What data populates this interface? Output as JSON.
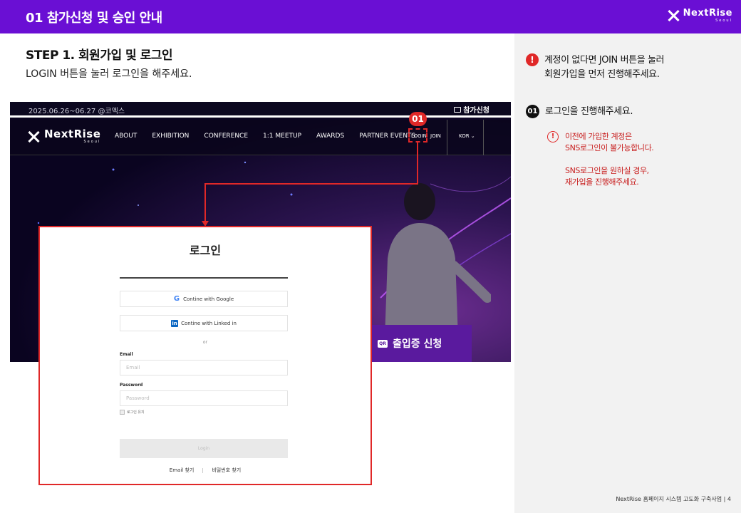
{
  "header": {
    "title": "01 참가신청 및 승인 안내",
    "brand_name": "NextRise",
    "brand_sub": "Seoul"
  },
  "step": {
    "title": "STEP 1.  회원가입 및 로그인",
    "description": "LOGIN 버튼을 눌러 로그인을 해주세요."
  },
  "site": {
    "date_info": "2025.06.26~06.27 @코엑스",
    "register_label": "참가신청",
    "logo_name": "NextRise",
    "logo_sub": "Seoul",
    "menu": [
      "ABOUT",
      "EXHIBITION",
      "CONFERENCE",
      "1:1 MEETUP",
      "AWARDS",
      "PARTNER EVENTS"
    ],
    "login": "LOGIN",
    "join": "JOIN",
    "language": "KOR ⌄",
    "qr_icon_text": "QR",
    "qr_label": "출입증 신청"
  },
  "callout": {
    "badge": "01"
  },
  "modal": {
    "title": "로그인",
    "google_icon": "G",
    "google_label": "Contine with Google",
    "linkedin_icon": "in",
    "linkedin_label": "Contine with Linked in",
    "or": "or",
    "email_label": "Email",
    "email_placeholder": "Email",
    "password_label": "Password",
    "password_placeholder": "Password",
    "remember_label": "로그인 유지",
    "login_button": "Login",
    "find_email": "Email 찾기",
    "find_password": "비밀번호 찾기"
  },
  "panel": {
    "alert_icon": "!",
    "alert_line1": "계정이 없다면 JOIN 버튼을 눌러",
    "alert_line2": "회원가입을 먼저 진행해주세요.",
    "step_number": "01",
    "step_text": "로그인을 진행해주세요.",
    "warn_icon": "!",
    "warn_line1": "이전에 가입한 계정은",
    "warn_line2": "SNS로그인이 불가능합니다.",
    "warn_line3": "SNS로그인을 원하실 경우,",
    "warn_line4": "재가입을 진행해주세요."
  },
  "footer": {
    "text": "NextRise 홈페이지 시스템 고도화 구축사업 | 4"
  },
  "colors": {
    "header_purple": "#6a0fd4",
    "accent_red": "#e02828",
    "panel_gray": "#f2f2f2"
  }
}
